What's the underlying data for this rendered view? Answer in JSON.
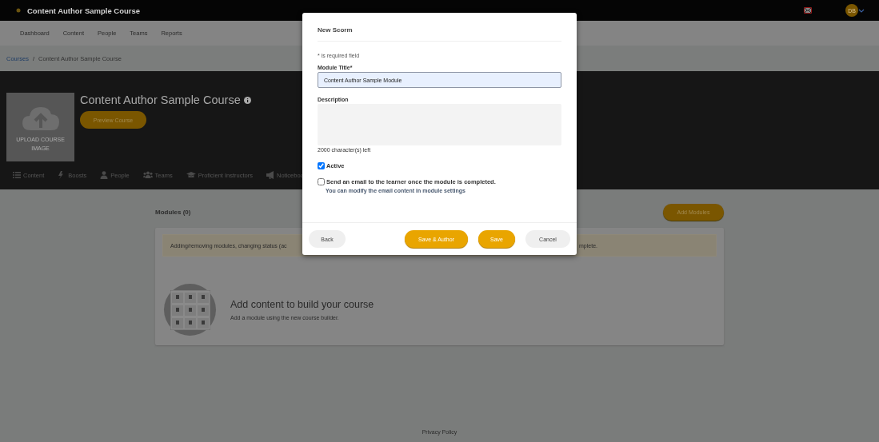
{
  "top_bar": {
    "title": "Content Author Sample Course",
    "avatar": "DB"
  },
  "nav": {
    "items": [
      {
        "label": "Dashboard"
      },
      {
        "label": "Content"
      },
      {
        "label": "People"
      },
      {
        "label": "Teams"
      },
      {
        "label": "Reports"
      }
    ]
  },
  "breadcrumb": {
    "separator": "/",
    "items": [
      {
        "label": "Courses",
        "link": true
      },
      {
        "label": "Content Author Sample Course",
        "link": false
      }
    ]
  },
  "course_header": {
    "upload_label": "UPLOAD COURSE IMAGE",
    "title": "Content Author Sample Course",
    "preview_button": "Preview Course",
    "tabs": [
      {
        "label": "Content"
      },
      {
        "label": "Boosts"
      },
      {
        "label": "People"
      },
      {
        "label": "Teams"
      },
      {
        "label": "Proficient Instructors"
      },
      {
        "label": "Noticeboa"
      }
    ]
  },
  "modules": {
    "heading": "Modules (0)",
    "add_button": "Add Modules",
    "notice_left": "Adding/removing modules, changing status (ac",
    "notice_right": "mplete.",
    "empty_title": "Add content to build your course",
    "empty_text": "Add a module using the new course builder."
  },
  "footer": {
    "link": "Privacy Policy"
  },
  "modal": {
    "title": "New Scorm",
    "required_note": "* is required field",
    "module_title_label": "Module Title*",
    "module_title_value": "Content Author Sample Module",
    "description_label": "Description",
    "chars_left": "2000 character(s) left",
    "options": [
      {
        "label": "Active",
        "checked": true
      },
      {
        "label": "Send an email to the learner once the module is completed.",
        "checked": false,
        "hint": "You can modify the email content in module settings"
      }
    ],
    "buttons": [
      {
        "label": "Back",
        "kind": "secondary"
      },
      {
        "label": "Save & Author",
        "kind": "primary"
      },
      {
        "label": "Save",
        "kind": "primary"
      },
      {
        "label": "Cancel",
        "kind": "secondary"
      }
    ]
  }
}
